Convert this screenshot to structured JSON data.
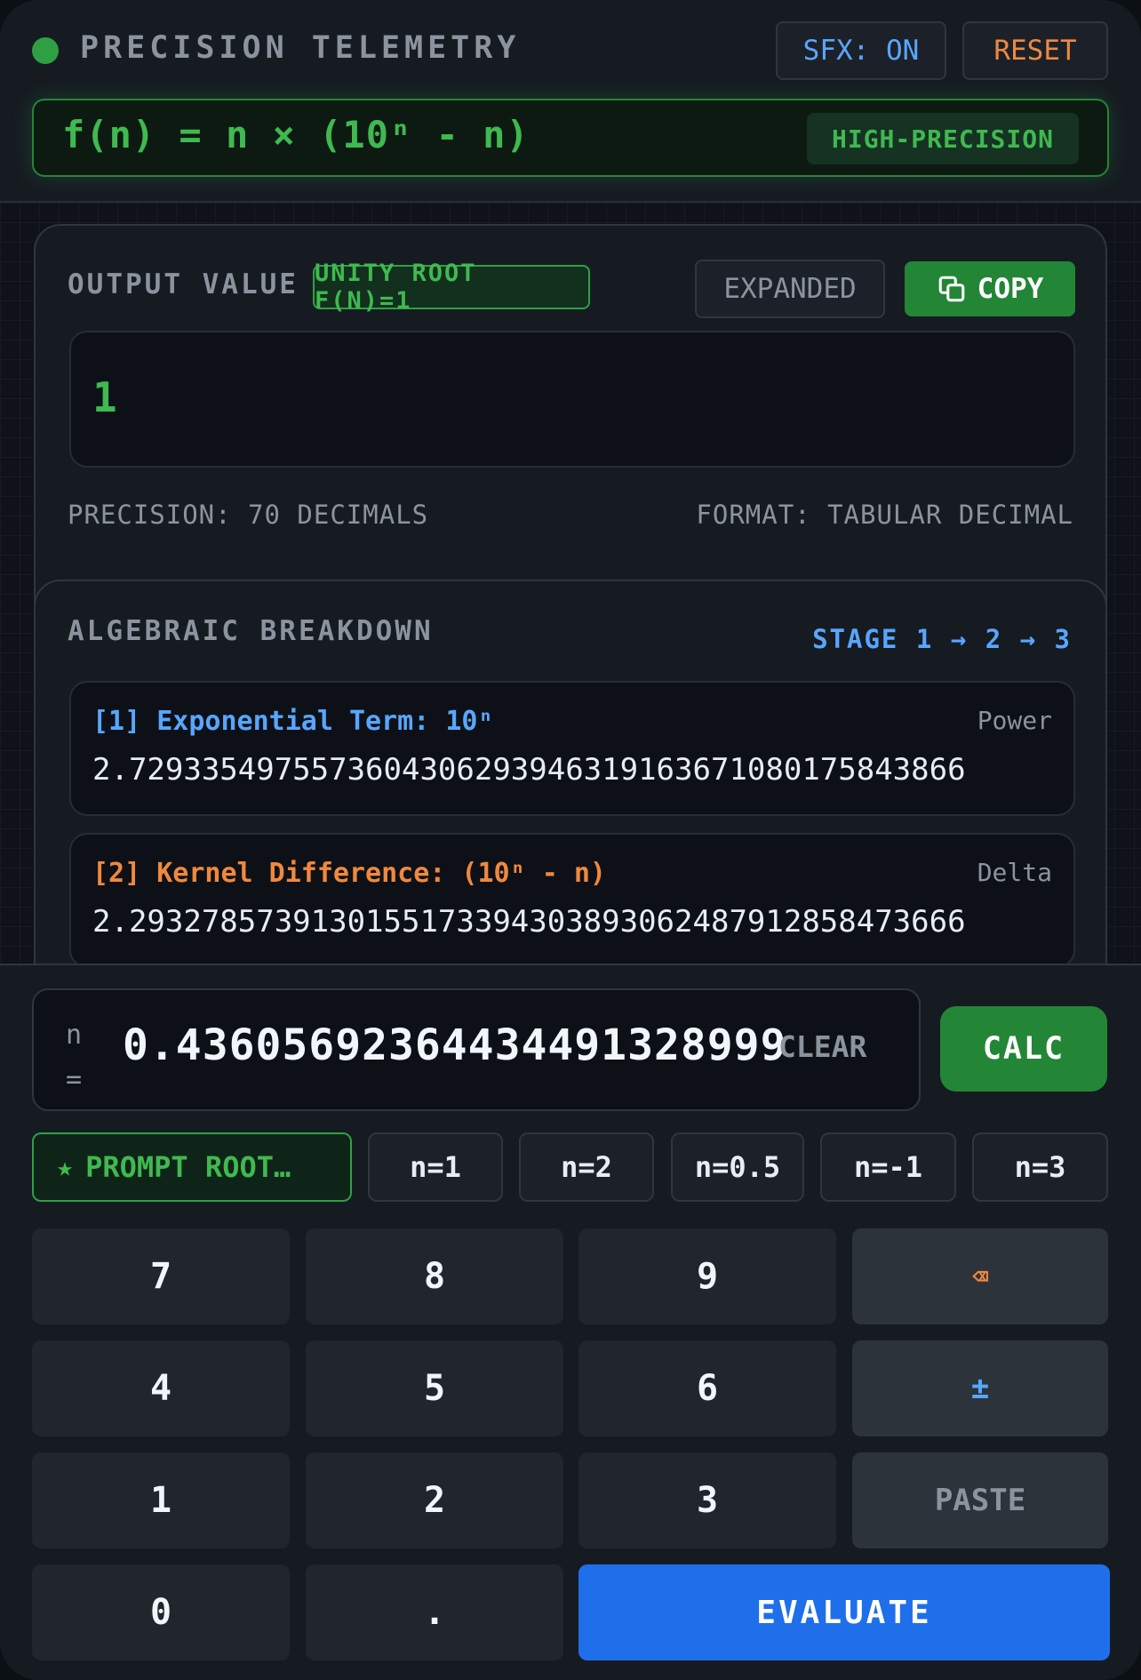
{
  "header": {
    "title": "PRECISION TELEMETRY",
    "sfx_label": "SFX: ON",
    "reset_label": "RESET",
    "formula": "f(n) = n × (10ⁿ - n)",
    "mode_badge": "HIGH-PRECISION"
  },
  "output": {
    "title": "OUTPUT VALUE",
    "badge": "UNITY ROOT F(N)=1",
    "expanded_label": "EXPANDED",
    "copy_label": "COPY",
    "value": "1",
    "precision": "PRECISION: 70 DECIMALS",
    "format": "FORMAT: TABULAR DECIMAL"
  },
  "breakdown": {
    "title": "ALGEBRAIC BREAKDOWN",
    "stages": "STAGE 1 → 2 → 3",
    "steps": [
      {
        "label": "[1] Exponential Term: 10ⁿ",
        "tag": "Power",
        "value": "2.7293354975573604306293946319163671080175843866",
        "color": "#58a6ff"
      },
      {
        "label": "[2] Kernel Difference: (10ⁿ - n)",
        "tag": "Delta",
        "value": "2.2932785739130155173394303893062487912858473666",
        "color": "#f0883e"
      }
    ]
  },
  "input": {
    "n_label": "n =",
    "value": "0.43605692364434491328999",
    "clear_label": "CLEAR",
    "calc_label": "CALC"
  },
  "presets": [
    {
      "label": "PROMPT ROOT…",
      "icon": "star-icon"
    },
    {
      "label": "n=1"
    },
    {
      "label": "n=2"
    },
    {
      "label": "n=0.5"
    },
    {
      "label": "n=-1"
    },
    {
      "label": "n=3"
    }
  ],
  "keypad": {
    "k7": "7",
    "k8": "8",
    "k9": "9",
    "backspace": "⌫",
    "k4": "4",
    "k5": "5",
    "k6": "6",
    "plus_minus": "±",
    "k1": "1",
    "k2": "2",
    "k3": "3",
    "paste": "PASTE",
    "k0": "0",
    "dot": ".",
    "evaluate": "EVALUATE"
  },
  "colors": {
    "accent_green": "#3fb950",
    "accent_blue": "#58a6ff",
    "accent_orange": "#f0883e",
    "evaluate_blue": "#1f6feb"
  }
}
